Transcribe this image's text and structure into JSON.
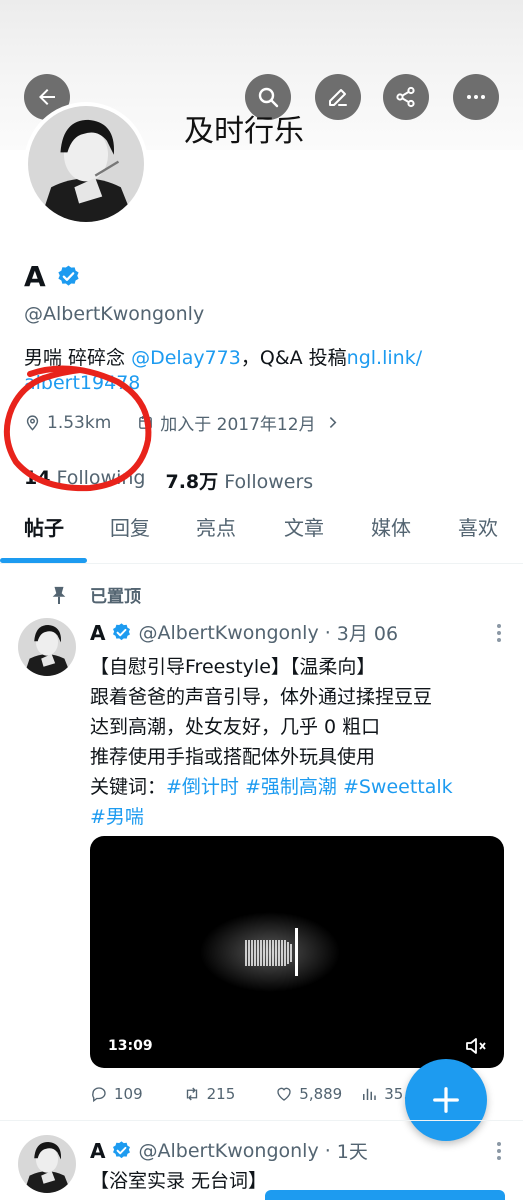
{
  "header": {
    "display_title": "及时行乐",
    "buttons": [
      {
        "icon": "back-arrow-icon"
      },
      {
        "icon": "search-icon"
      },
      {
        "icon": "edit-icon"
      },
      {
        "icon": "share-icon"
      },
      {
        "icon": "more-icon"
      }
    ]
  },
  "profile": {
    "name": "A",
    "verified_icon": "verified-badge-icon",
    "handle": "@AlbertKwongonly",
    "bio": {
      "prefix": "男喘 碎碎念 ",
      "mention": "@Delay773",
      "middle": "，Q&A 投稿",
      "link_line1": "ngl.link/",
      "link_line2": "albert19478"
    },
    "location": "1.53km",
    "joined": "加入于 2017年12月",
    "following_count": "14",
    "following_label": "Following",
    "followers_count": "7.8万",
    "followers_label": "Followers"
  },
  "tabs": [
    "帖子",
    "回复",
    "亮点",
    "文章",
    "媒体",
    "喜欢"
  ],
  "active_tab": "帖子",
  "pinned_label": "已置顶",
  "tweets": [
    {
      "name": "A",
      "handle": "@AlbertKwongonly",
      "separator": "·",
      "time": "3月 06",
      "lines": [
        "【自慰引导Freestyle】【温柔向】",
        "跟着爸爸的声音引导，体外通过揉捏豆豆",
        "达到高潮，处女友好，几乎 0 粗口",
        "推荐使用手指或搭配体外玩具使用"
      ],
      "keywords_label": "关键词：",
      "hashtags": [
        "#倒计时",
        "#强制高潮",
        "#Sweettalk",
        "#男喘"
      ],
      "video_duration": "13:09",
      "stats": {
        "replies": "109",
        "retweets": "215",
        "likes": "5,889",
        "views": "35."
      }
    },
    {
      "name": "A",
      "handle": "@AlbertKwongonly",
      "separator": "·",
      "time": "1天",
      "text": "【浴室实录 无台词】"
    }
  ],
  "colors": {
    "accent": "#1d9bf0",
    "annotation": "#e8231b",
    "button_bg": "#6e6e6e"
  }
}
